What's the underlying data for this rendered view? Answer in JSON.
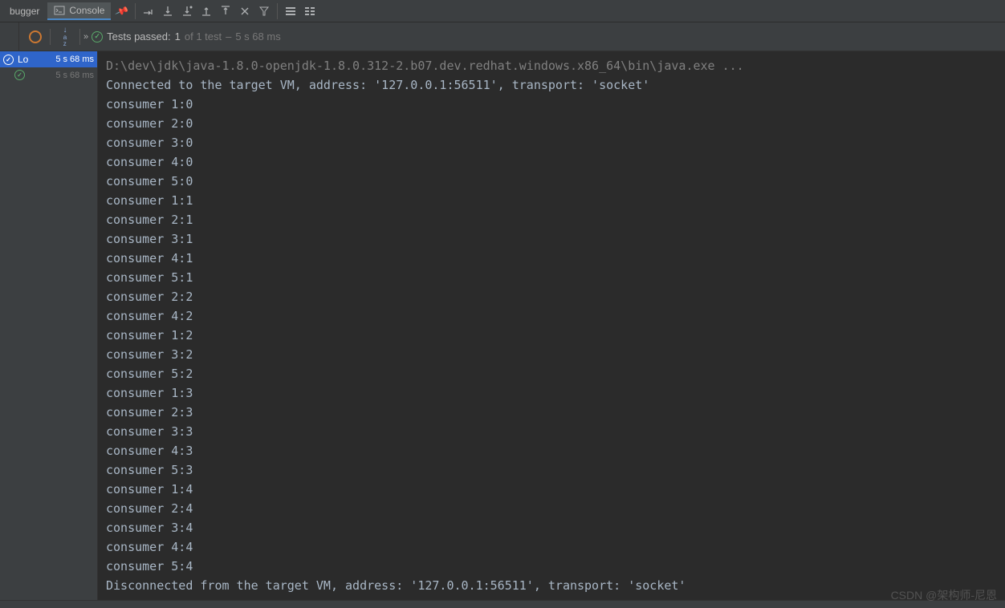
{
  "tabs": {
    "debugger": "bugger",
    "console": "Console"
  },
  "status": {
    "label_prefix": "Tests passed:",
    "passed_count": "1",
    "of_text": "of 1 test",
    "dash": "–",
    "duration": "5 s 68 ms"
  },
  "sidebar": {
    "items": [
      {
        "label": "Lo",
        "time": "5 s 68 ms",
        "selected": true
      },
      {
        "label": "",
        "time": "5 s 68 ms",
        "selected": false
      }
    ]
  },
  "console": {
    "cmd": "D:\\dev\\jdk\\java-1.8.0-openjdk-1.8.0.312-2.b07.dev.redhat.windows.x86_64\\bin\\java.exe ...",
    "lines": [
      "Connected to the target VM, address: '127.0.0.1:56511', transport: 'socket'",
      "consumer 1:0",
      "consumer 2:0",
      "consumer 3:0",
      "consumer 4:0",
      "consumer 5:0",
      "consumer 1:1",
      "consumer 2:1",
      "consumer 3:1",
      "consumer 4:1",
      "consumer 5:1",
      "consumer 2:2",
      "consumer 4:2",
      "consumer 1:2",
      "consumer 3:2",
      "consumer 5:2",
      "consumer 1:3",
      "consumer 2:3",
      "consumer 3:3",
      "consumer 4:3",
      "consumer 5:3",
      "consumer 1:4",
      "consumer 2:4",
      "consumer 3:4",
      "consumer 4:4",
      "consumer 5:4",
      "Disconnected from the target VM, address: '127.0.0.1:56511', transport: 'socket'"
    ]
  },
  "watermark": "CSDN @架构师-尼恩"
}
